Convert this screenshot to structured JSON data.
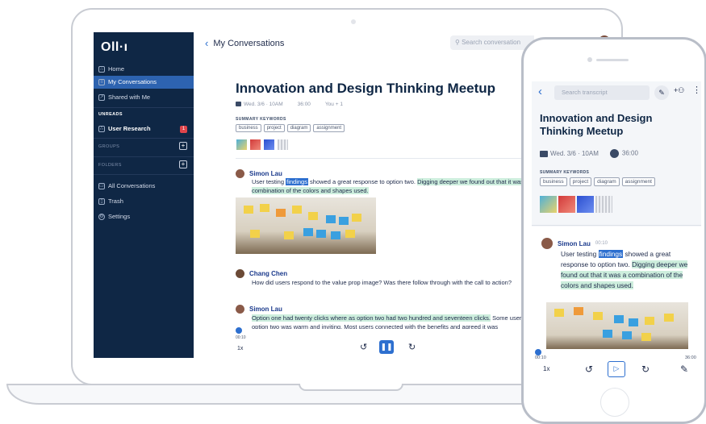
{
  "colors": {
    "accent": "#2d6fcf",
    "sidebar": "#0f2745",
    "highlight_green": "#cdeedd",
    "badge": "#e0454b"
  },
  "desktop": {
    "logo": "Oll·ı",
    "sidebar": {
      "items": [
        {
          "label": "Home",
          "icon": "home-icon"
        },
        {
          "label": "My Conversations",
          "icon": "list-icon",
          "active": true
        },
        {
          "label": "Shared with Me",
          "icon": "share-icon"
        }
      ],
      "unreads_heading": "UNREADS",
      "unread_item": {
        "label": "User Research",
        "badge": "1"
      },
      "groups_heading": "GROUPS",
      "folders_heading": "FOLDERS",
      "bottom_items": [
        {
          "label": "All Conversations",
          "icon": "folder-icon"
        },
        {
          "label": "Trash",
          "icon": "trash-icon"
        },
        {
          "label": "Settings",
          "icon": "gear-icon"
        }
      ]
    },
    "header": {
      "back_label": "My Conversations",
      "search_placeholder": "Search conversation"
    },
    "meeting": {
      "title": "Innovation and Design Thinking Meetup",
      "date": "Wed. 3/6 · 10AM",
      "duration": "36:00",
      "participants": "You + 1",
      "keywords_heading": "SUMMARY KEYWORDS",
      "keywords": [
        "business",
        "project",
        "diagram",
        "assignment"
      ]
    },
    "transcript": [
      {
        "speaker": "Simon Lau",
        "pre": "User testing ",
        "highlight_blue": "findings",
        "mid": " showed a great response to option two. ",
        "highlight_green": "Digging deeper we found out that it was a combination of the colors and shapes used."
      },
      {
        "speaker": "Chang Chen",
        "text": "How did users respond to the value prop image? Was there follow through with the call to action?"
      },
      {
        "speaker": "Simon Lau",
        "highlight_green": "Option one had twenty clicks where as option two had two hundred and seventeen clicks.",
        "rest": " Some users said option two was warm and inviting. Most users connected with the benefits and agreed it was"
      }
    ],
    "player": {
      "time": "00:10",
      "speed": "1x",
      "progress": 0.005
    }
  },
  "mobile": {
    "search_placeholder": "Search transcript",
    "title": "Innovation and Design Thinking Meetup",
    "date": "Wed. 3/6 · 10AM",
    "duration": "36:00",
    "keywords_heading": "SUMMARY KEYWORDS",
    "keywords": [
      "business",
      "project",
      "diagram",
      "assignment"
    ],
    "speaker": "Simon Lau",
    "speaker_time": "00:10",
    "para_pre": "User testing ",
    "para_blue": "findings",
    "para_mid": " showed a great response to option two. ",
    "para_green": "Digging deeper we found out that it was a combination of the colors and shapes used.",
    "player": {
      "start": "00:10",
      "end": "36:00",
      "speed": "1x"
    }
  }
}
